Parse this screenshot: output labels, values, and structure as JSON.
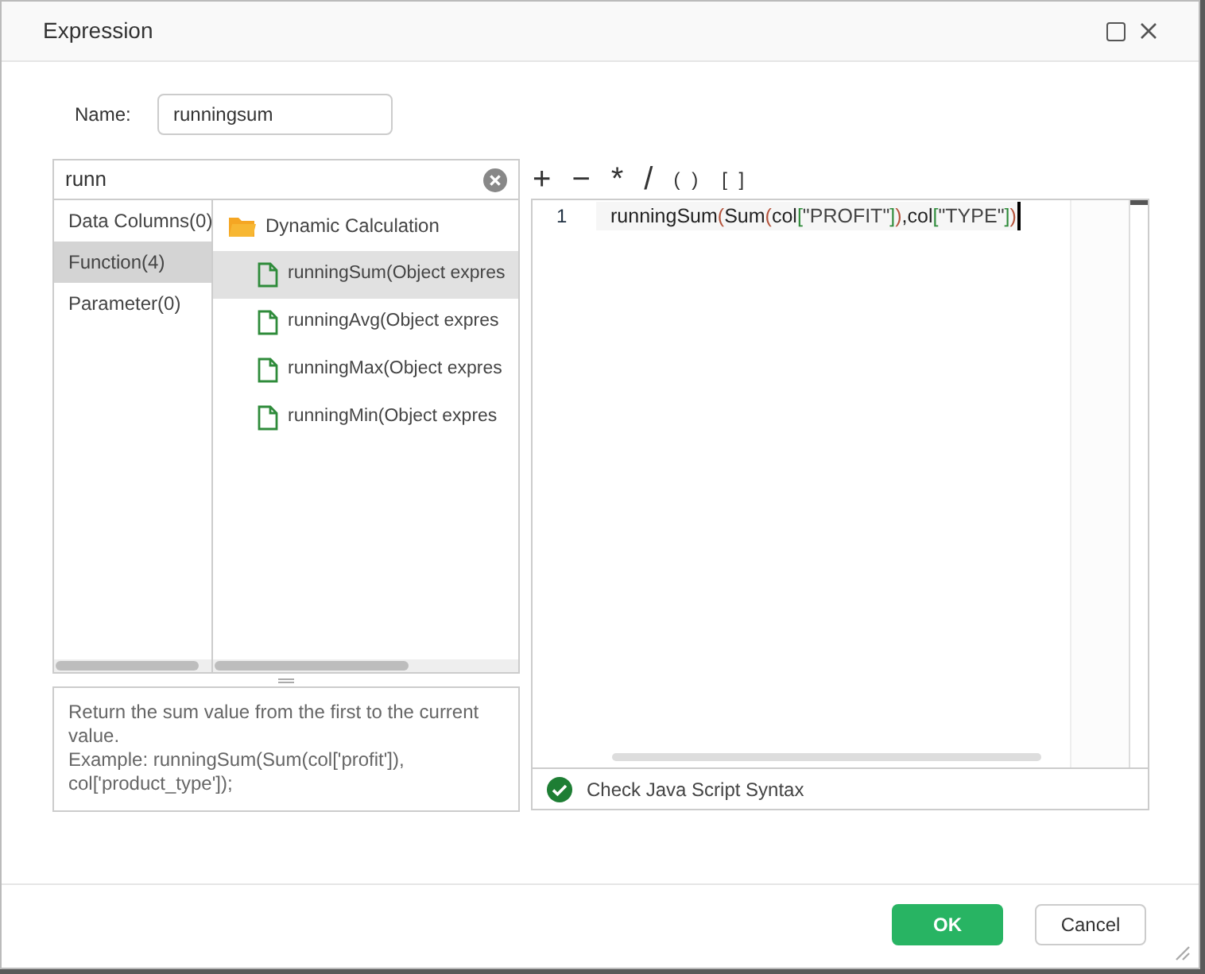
{
  "window": {
    "title": "Expression"
  },
  "name_field": {
    "label": "Name:",
    "value": "runningsum"
  },
  "search": {
    "value": "runn"
  },
  "categories": [
    {
      "label": "Data Columns(0)",
      "selected": false
    },
    {
      "label": "Function(4)",
      "selected": true
    },
    {
      "label": "Parameter(0)",
      "selected": false
    }
  ],
  "function_tree": {
    "label": "Dynamic Calculation",
    "children": [
      {
        "label": "runningSum(Object expres",
        "selected": true
      },
      {
        "label": "runningAvg(Object expres",
        "selected": false
      },
      {
        "label": "runningMax(Object expres",
        "selected": false
      },
      {
        "label": "runningMin(Object expres",
        "selected": false
      }
    ]
  },
  "description": [
    "Return the sum value from the first to the current value.",
    "Example: runningSum(Sum(col['profit']), col['product_type']);"
  ],
  "operators": [
    "+",
    "−",
    "*",
    "/",
    "( )",
    "[ ]"
  ],
  "editor": {
    "line_number": "1",
    "tokens": [
      {
        "text": "runningSum",
        "kind": "plain"
      },
      {
        "text": "(",
        "kind": "paren"
      },
      {
        "text": "Sum",
        "kind": "plain"
      },
      {
        "text": "(",
        "kind": "paren"
      },
      {
        "text": "col",
        "kind": "plain"
      },
      {
        "text": "[",
        "kind": "bracket"
      },
      {
        "text": "\"PROFIT\"",
        "kind": "string"
      },
      {
        "text": "]",
        "kind": "bracket"
      },
      {
        "text": ")",
        "kind": "paren"
      },
      {
        "text": ",col",
        "kind": "plain"
      },
      {
        "text": "[",
        "kind": "bracket"
      },
      {
        "text": "\"TYPE\"",
        "kind": "string"
      },
      {
        "text": "]",
        "kind": "bracket"
      },
      {
        "text": ")",
        "kind": "paren"
      }
    ]
  },
  "syntax_check": {
    "label": "Check Java Script Syntax",
    "passed": true
  },
  "buttons": [
    {
      "label": "OK",
      "kind": "primary"
    },
    {
      "label": "Cancel",
      "kind": "secondary"
    }
  ]
}
